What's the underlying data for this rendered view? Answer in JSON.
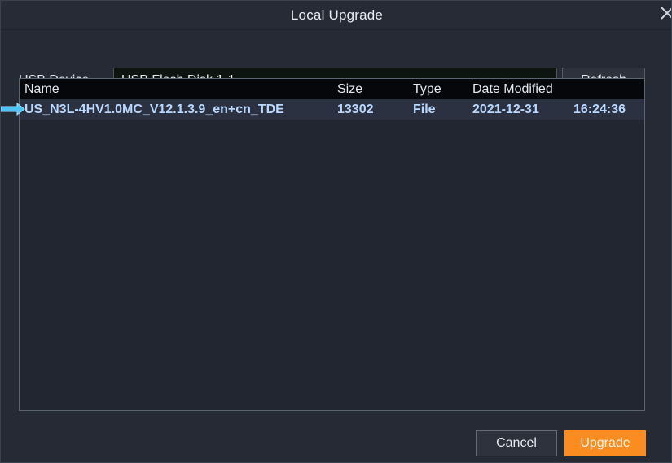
{
  "window": {
    "title": "Local Upgrade",
    "close_icon": "close-icon",
    "accent_color": "#fa8c20",
    "background_color": "#252a35",
    "panel_color": "#212630",
    "selection_color": "#2b3140",
    "selected_text_color": "#b9d8ff"
  },
  "usb_row": {
    "label": "USB Device",
    "device_value": "USB Flash Disk 1-1",
    "device_placeholder": "USB Flash Disk 1-1",
    "chevron_icon": "chevron-down-icon",
    "refresh_label": "Refresh"
  },
  "file_list": {
    "columns": [
      "Name",
      "Size",
      "Type",
      "Date Modified"
    ],
    "rows": [
      {
        "name": "US_N3L-4HV1.0MC_V12.1.3.9_en+cn_TDE",
        "size": "13302",
        "type": "File",
        "date": "2021-12-31",
        "time": "16:24:36",
        "selected": true
      }
    ]
  },
  "footer": {
    "cancel_label": "Cancel",
    "upgrade_label": "Upgrade"
  },
  "pointer": {
    "icon": "arrow-pointer-icon",
    "color": "#3fc3f0"
  }
}
